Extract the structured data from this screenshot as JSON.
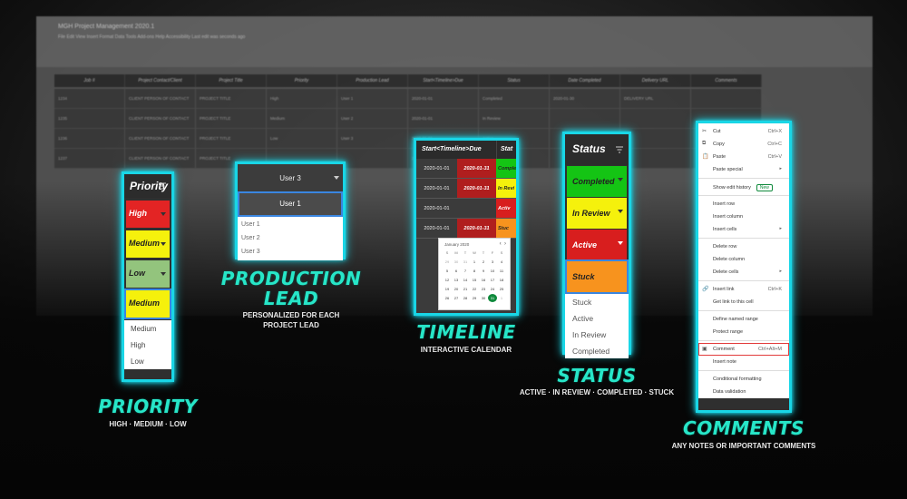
{
  "sheet": {
    "title": "MGH Project Management 2020.1",
    "menu": [
      "File",
      "Edit",
      "View",
      "Insert",
      "Format",
      "Data",
      "Tools",
      "Add-ons",
      "Help",
      "Accessibility",
      "Last edit was seconds ago"
    ],
    "headers": [
      "Job #",
      "Project Contact/Client",
      "Project Title",
      "Priority",
      "Production Lead",
      "Start<Timeline>Due",
      "Status",
      "Date Completed",
      "Delivery URL",
      "Comments"
    ],
    "rows": [
      [
        "1234",
        "CLIENT PERSON OF CONTACT",
        "PROJECT TITLE",
        "High",
        "User 1",
        "2020-01-01",
        "Completed",
        "2020-01-30",
        "DELIVERY URL",
        ""
      ],
      [
        "1235",
        "CLIENT PERSON OF CONTACT",
        "PROJECT TITLE",
        "Medium",
        "User 2",
        "2020-01-01",
        "In Review",
        "",
        "",
        ""
      ],
      [
        "1236",
        "CLIENT PERSON OF CONTACT",
        "PROJECT TITLE",
        "Low",
        "User 3",
        "2020-01-01",
        "Active",
        "",
        "",
        ""
      ],
      [
        "1237",
        "CLIENT PERSON OF CONTACT",
        "PROJECT TITLE",
        "",
        "",
        "2020-01-01",
        "Stuck",
        "",
        "",
        ""
      ]
    ]
  },
  "priority": {
    "header": "Priority",
    "cells": [
      {
        "label": "High",
        "color": "#e32424"
      },
      {
        "label": "Medium",
        "color": "#f5f10c"
      },
      {
        "label": "Low",
        "color": "#93c47d"
      },
      {
        "label": "Medium",
        "color": "#f5f10c"
      }
    ],
    "options": [
      "Medium",
      "High",
      "Low"
    ],
    "caption_title": "PRIORITY",
    "caption_sub": "HIGH · MEDIUM · LOW"
  },
  "production_lead": {
    "current": "User 3",
    "editing": "User 1",
    "options": [
      "User 1",
      "User 2",
      "User 3"
    ],
    "caption_title_1": "PRODUCTION",
    "caption_title_2": "LEAD",
    "caption_sub_1": "PERSONALIZED FOR EACH",
    "caption_sub_2": "PROJECT LEAD"
  },
  "timeline": {
    "header": "Start<Timeline>Due",
    "status_header": "Stat",
    "rows": [
      {
        "start": "2020-01-01",
        "due": "2020-01-31",
        "due_color": "#b01e1e",
        "status": "Comple",
        "status_color": "#14c414"
      },
      {
        "start": "2020-01-01",
        "due": "2020-01-31",
        "due_color": "#b01e1e",
        "status": "In Revi",
        "status_color": "#f5f10c"
      },
      {
        "start": "2020-01-01",
        "due": "",
        "due_color": "#3b3b3b",
        "status": "Activ",
        "status_color": "#d81e1e"
      },
      {
        "start": "2020-01-01",
        "due": "2020-01-31",
        "due_color": "#b01e1e",
        "status": "Stuc",
        "status_color": "#f7931e"
      }
    ],
    "calendar": {
      "month": "January 2020",
      "weekdays": [
        "S",
        "M",
        "T",
        "W",
        "T",
        "F",
        "S"
      ],
      "days": [
        "29",
        "30",
        "31",
        "1",
        "2",
        "3",
        "4",
        "5",
        "6",
        "7",
        "8",
        "9",
        "10",
        "11",
        "12",
        "13",
        "14",
        "15",
        "16",
        "17",
        "18",
        "19",
        "20",
        "21",
        "22",
        "23",
        "24",
        "25",
        "26",
        "27",
        "28",
        "29",
        "30",
        "31",
        "1"
      ],
      "selected": "31"
    },
    "caption_title": "TIMELINE",
    "caption_sub": "INTERACTIVE CALENDAR"
  },
  "status": {
    "header": "Status",
    "cells": [
      {
        "label": "Completed",
        "color": "#14c414"
      },
      {
        "label": "In Review",
        "color": "#f5f10c"
      },
      {
        "label": "Active",
        "color": "#d81e1e"
      },
      {
        "label": "Stuck",
        "color": "#f7931e"
      }
    ],
    "options": [
      "Stuck",
      "Active",
      "In Review",
      "Completed"
    ],
    "caption_title": "STATUS",
    "caption_sub": "ACTIVE · IN REVIEW · COMPLETED · STUCK"
  },
  "context_menu": {
    "items": [
      {
        "icon": "✂",
        "label": "Cut",
        "shortcut": "Ctrl+X"
      },
      {
        "icon": "⧉",
        "label": "Copy",
        "shortcut": "Ctrl+C"
      },
      {
        "icon": "📋",
        "label": "Paste",
        "shortcut": "Ctrl+V"
      },
      {
        "label": "Paste special",
        "arrow": "▸"
      },
      {
        "sep": true
      },
      {
        "label": "Show edit history",
        "badge": "New"
      },
      {
        "sep": true
      },
      {
        "label": "Insert row"
      },
      {
        "label": "Insert column"
      },
      {
        "label": "Insert cells",
        "arrow": "▸"
      },
      {
        "sep": true
      },
      {
        "label": "Delete row"
      },
      {
        "label": "Delete column"
      },
      {
        "label": "Delete cells",
        "arrow": "▸"
      },
      {
        "sep": true
      },
      {
        "icon": "🔗",
        "label": "Insert link",
        "shortcut": "Ctrl+K"
      },
      {
        "label": "Get link to this cell"
      },
      {
        "sep": true
      },
      {
        "label": "Define named range"
      },
      {
        "label": "Protect range"
      },
      {
        "sep": true
      },
      {
        "icon": "▣",
        "label": "Comment",
        "shortcut": "Ctrl+Alt+M",
        "highlight": true
      },
      {
        "label": "Insert note"
      },
      {
        "sep": true
      },
      {
        "label": "Conditional formatting"
      },
      {
        "label": "Data validation"
      }
    ],
    "caption_title": "COMMENTS",
    "caption_sub": "ANY NOTES OR IMPORTANT COMMENTS"
  },
  "colors": {
    "accent_glow": "#19d6e6",
    "caption": "#27e6c8"
  }
}
